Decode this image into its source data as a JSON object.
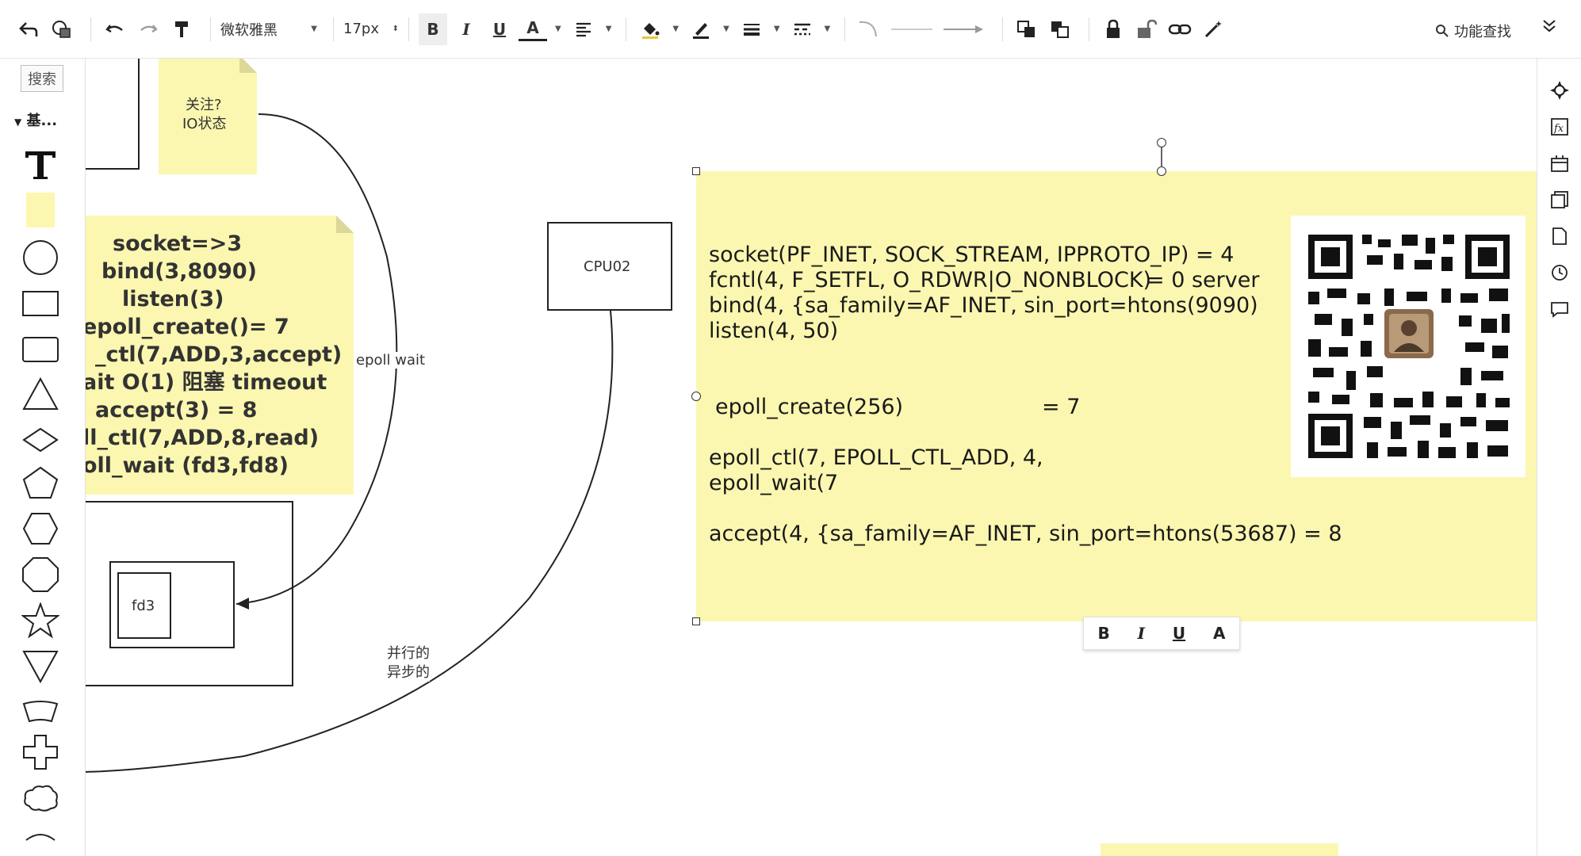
{
  "toolbar": {
    "font_name": "微软雅黑",
    "font_size": "17px",
    "bold": "B",
    "italic": "I",
    "underline": "U",
    "font_color": "A",
    "search_label": "功能查找"
  },
  "left_panel": {
    "search_placeholder": "搜索",
    "category_label": "基..."
  },
  "canvas": {
    "top_note": {
      "line1": "关注?",
      "line2": "IO状态"
    },
    "left_note_lines": [
      "socket=>3",
      "bind(3,8090)",
      "listen(3)",
      "epoll_create()= 7",
      "_ctl(7,ADD,3,accept)",
      "ait  O(1)  阻塞  timeout",
      "accept(3)  =  8",
      "ll_ctl(7,ADD,8,read)",
      "oll_wait  (fd3,fd8)"
    ],
    "epoll_wait_label": "epoll  wait",
    "cpu_label": "CPU02",
    "fd3_label": "fd3",
    "parallel_label": "并行的",
    "async_label": "异步的",
    "main_note": {
      "line1": "socket(PF_INET, SOCK_STREAM, IPPROTO_IP) = 4",
      "line2_a": "fcntl(4, F_SETFL, O_RDWR|O_NONBLOCK)",
      "line2_b": "= 0   server",
      "line3": "bind(4, {sa_family=AF_INET, sin_port=htons(9090)",
      "line4": "listen(4, 50)",
      "line5_a": "epoll_create(256)",
      "line5_b": "= 7",
      "line6": "epoll_ctl(7, EPOLL_CTL_ADD, 4,",
      "line7": "epoll_wait(7",
      "line8": "accept(4, {sa_family=AF_INET, sin_port=htons(53687) = 8"
    },
    "mini_toolbar": {
      "bold": "B",
      "italic": "I",
      "underline": "U",
      "color": "A"
    }
  },
  "icons": {
    "undo": "undo-icon",
    "redo": "redo-icon",
    "format_painter": "format-painter-icon",
    "lock": "lock-icon",
    "unlock": "unlock-icon",
    "link": "link-icon",
    "magic": "magic-wand-icon"
  },
  "colors": {
    "sticky": "#fbf7b0",
    "accent": "#333333"
  }
}
